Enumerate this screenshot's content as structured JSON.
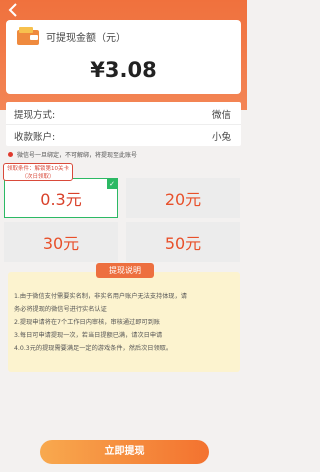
{
  "header": {
    "back_icon": "back-arrow-icon"
  },
  "balance": {
    "wallet_icon": "wallet-icon",
    "label": "可提现金额（元）",
    "value": "¥3.08"
  },
  "info": {
    "method_label": "提现方式:",
    "method_value": "微信",
    "account_label": "收款账户:",
    "account_value": "小兔"
  },
  "note": {
    "text": "微信号一旦绑定，不可解绑，将提现至此账号"
  },
  "amounts": [
    {
      "label": "0.3元",
      "selected": true
    },
    {
      "label": "20元",
      "selected": false
    },
    {
      "label": "30元",
      "selected": false
    },
    {
      "label": "50元",
      "selected": false
    }
  ],
  "condition": {
    "line1": "领取条件：解锁第10关卡",
    "line2": "（次日领取）"
  },
  "tips": {
    "title": "提现说明",
    "lines": [
      "1.由于微信支付需要实名制，非实名用户账户无法支持体现，请",
      "务必将提现的微信号进行实名认证",
      "2.提现申请将在7个工作日内审核，审核通过即可到账",
      "3.每日可申请提现一次，若当日提额已满，请次日申请",
      "4.0.3元的提现需要满足一定的游戏条件，然后次日领取。"
    ]
  },
  "action": {
    "withdraw_label": "立即提现"
  },
  "colors": {
    "accent": "#f0713d",
    "selected_border": "#2cb964",
    "amount_text": "#e8502a"
  }
}
